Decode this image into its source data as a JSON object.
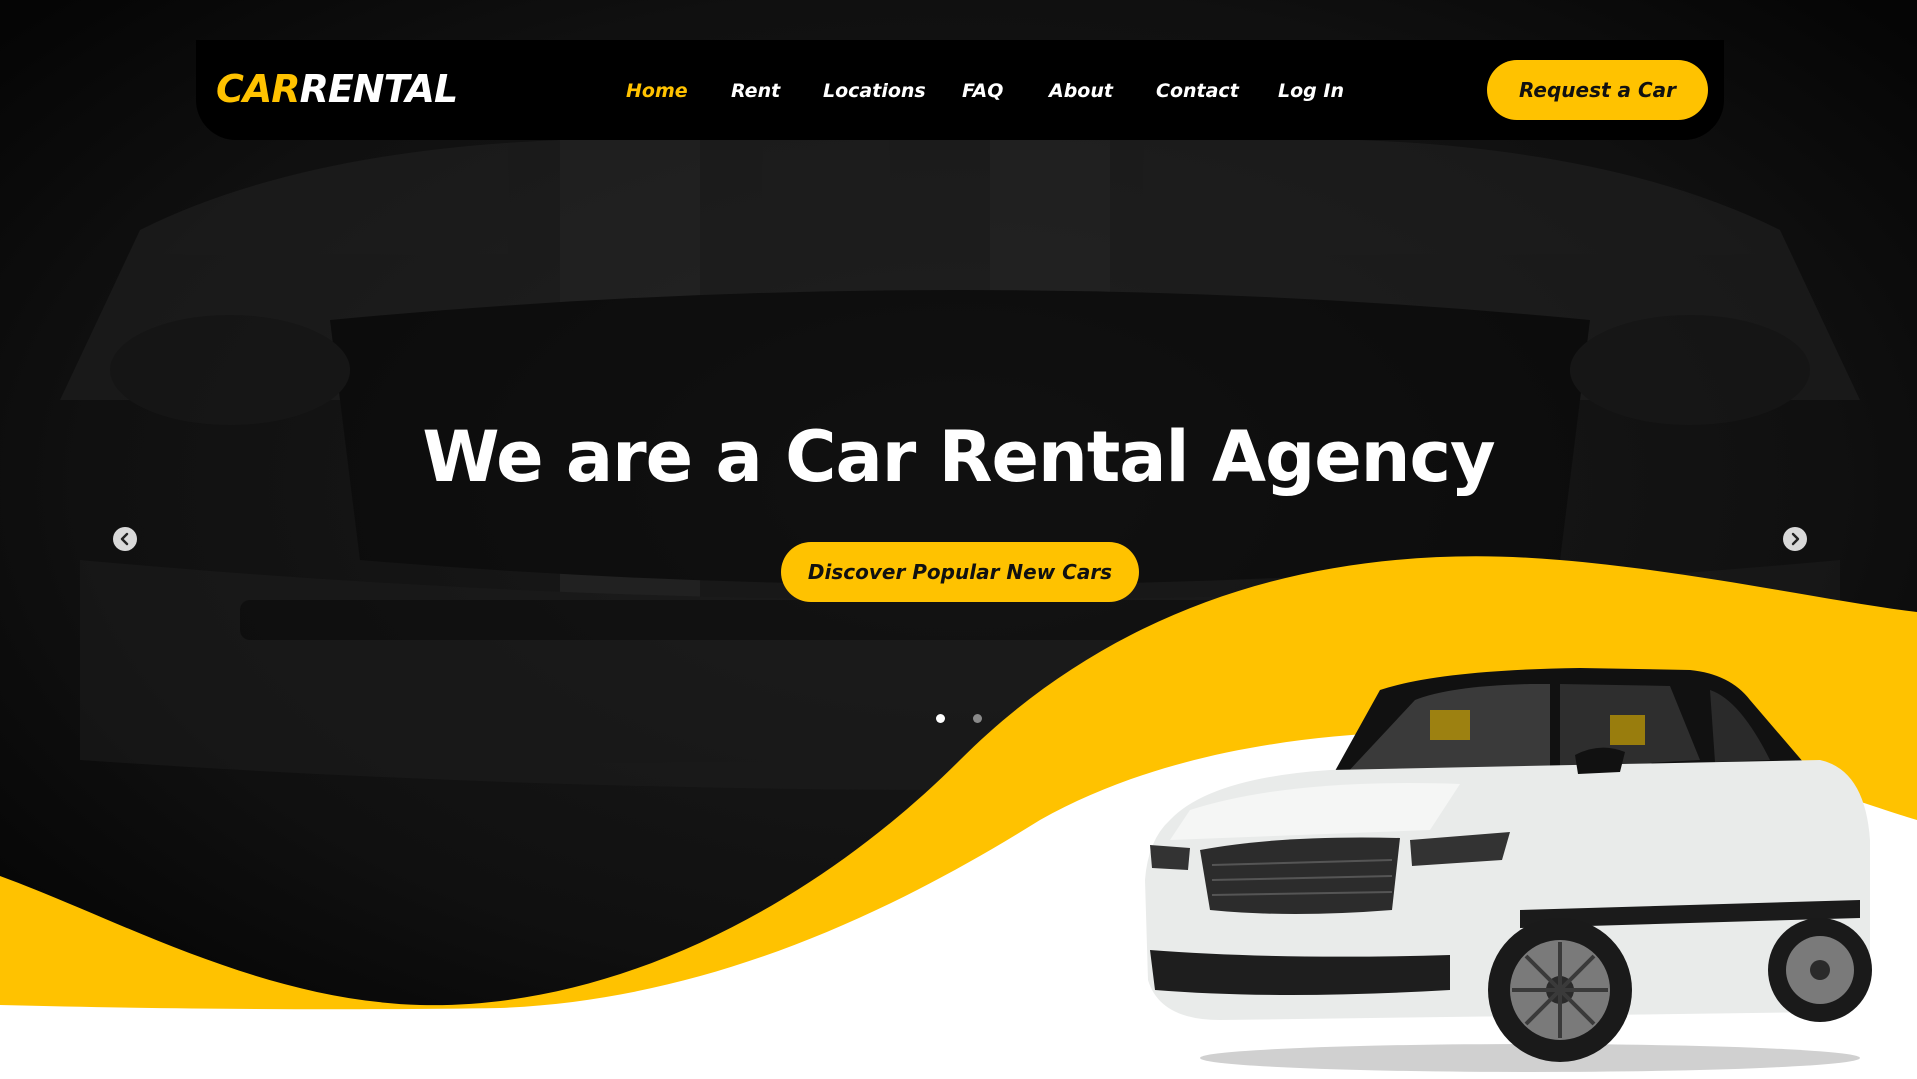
{
  "brand": {
    "logo_car": "CAR",
    "logo_rental": "RENTAL"
  },
  "nav": {
    "items": [
      {
        "label": "Home",
        "active": true
      },
      {
        "label": "Rent",
        "active": false
      },
      {
        "label": "Locations",
        "active": false
      },
      {
        "label": "FAQ",
        "active": false
      },
      {
        "label": "About",
        "active": false
      },
      {
        "label": "Contact",
        "active": false
      },
      {
        "label": "Log In",
        "active": false
      }
    ],
    "cta_label": "Request a Car"
  },
  "hero": {
    "title": "We are a Car Rental Agency",
    "cta_label": "Discover Popular New Cars",
    "slides_total": 2,
    "slide_active": 1
  },
  "icons": {
    "prev": "chevron-left-icon",
    "next": "chevron-right-icon"
  },
  "colors": {
    "accent": "#ffc200",
    "dark": "#000000",
    "text_light": "#ffffff"
  }
}
